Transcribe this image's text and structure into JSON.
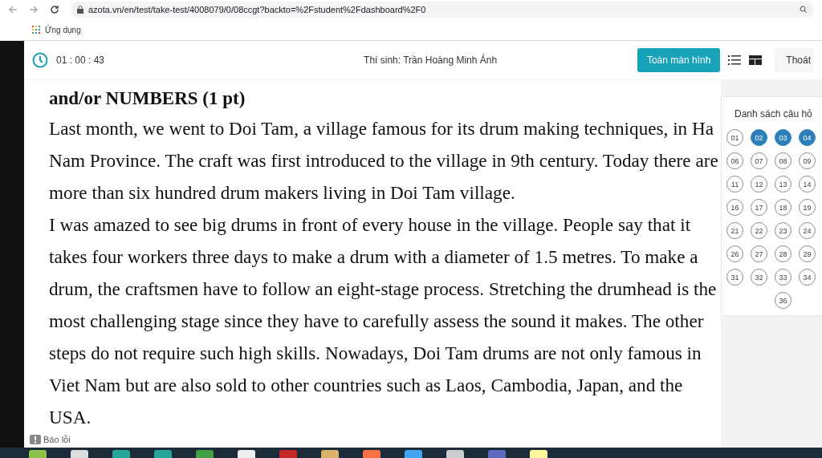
{
  "browser": {
    "url": "azota.vn/en/test/take-test/4008079/0/08ccgt?backto=%2Fstudent%2Fdashboard%2F0",
    "bookmark": "Ứng dụng"
  },
  "header": {
    "timer": "01 : 00 : 43",
    "candidate": "Thí sinh: Trần Hoàng Minh Ánh",
    "fullscreen_button": "Toàn màn hình",
    "exit_button": "Thoát"
  },
  "question": {
    "title": "and/or NUMBERS (1 pt)",
    "paragraphs": [
      "Last month, we went to Doi Tam, a village famous for its drum making techniques, in Ha Nam Province. The craft was first introduced to the village in 9th century. Today there are more than six hundred drum makers living in Doi Tam village.",
      "I was amazed to see big drums in front of every house in the village. People say that it takes four workers three days to make a drum with a diameter of 1.5 metres. To make a drum, the craftsmen have to follow an eight-stage process. Stretching the drumhead is the most challenging stage since they have to carefully assess the sound it makes. The other steps do not require such high skills. Nowadays, Doi Tam drums are not only famous in Viet Nam but are also sold to other countries such as Laos, Cambodia, Japan, and the USA."
    ]
  },
  "report": "Báo lỗi",
  "question_list": {
    "title": "Danh sách câu hỏ",
    "items": [
      {
        "label": "01",
        "selected": false
      },
      {
        "label": "02",
        "selected": true
      },
      {
        "label": "03",
        "selected": true
      },
      {
        "label": "04",
        "selected": true
      },
      {
        "label": "06",
        "selected": false
      },
      {
        "label": "07",
        "selected": false
      },
      {
        "label": "08",
        "selected": false
      },
      {
        "label": "09",
        "selected": false
      },
      {
        "label": "11",
        "selected": false
      },
      {
        "label": "12",
        "selected": false
      },
      {
        "label": "13",
        "selected": false
      },
      {
        "label": "14",
        "selected": false
      },
      {
        "label": "16",
        "selected": false
      },
      {
        "label": "17",
        "selected": false
      },
      {
        "label": "18",
        "selected": false
      },
      {
        "label": "19",
        "selected": false
      },
      {
        "label": "21",
        "selected": false
      },
      {
        "label": "22",
        "selected": false
      },
      {
        "label": "23",
        "selected": false
      },
      {
        "label": "24",
        "selected": false
      },
      {
        "label": "26",
        "selected": false
      },
      {
        "label": "27",
        "selected": false
      },
      {
        "label": "28",
        "selected": false
      },
      {
        "label": "29",
        "selected": false
      },
      {
        "label": "31",
        "selected": false
      },
      {
        "label": "32",
        "selected": false
      },
      {
        "label": "33",
        "selected": false
      },
      {
        "label": "34",
        "selected": false
      }
    ],
    "last": {
      "label": "36",
      "selected": false
    }
  }
}
